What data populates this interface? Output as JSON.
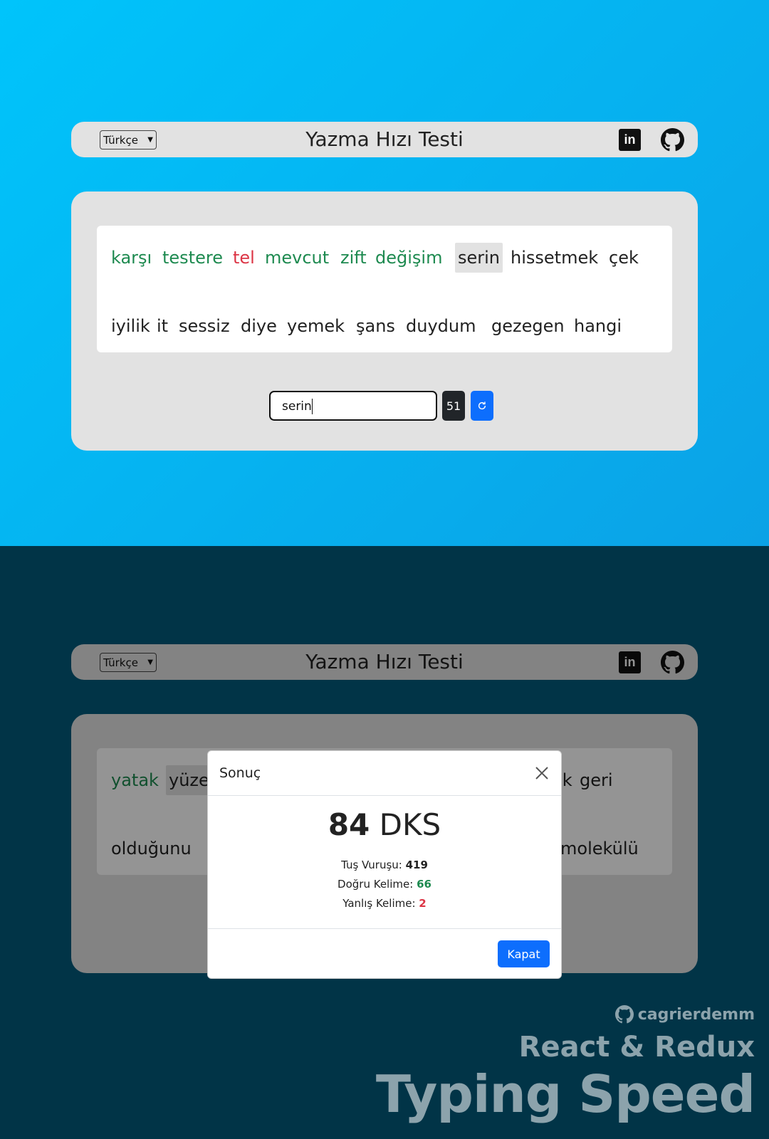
{
  "app_title": "Yazma Hızı Testi",
  "language": {
    "selected": "Türkçe"
  },
  "icons": {
    "linkedin": "linkedin-icon",
    "github": "github-icon",
    "refresh": "refresh-icon",
    "close": "close-icon"
  },
  "colors": {
    "correct": "#1e8a50",
    "wrong": "#dc3545",
    "primary": "#0d6efd",
    "dark": "#212529"
  },
  "top_test": {
    "line1": [
      {
        "text": "karşı",
        "status": "correct"
      },
      {
        "text": "testere",
        "status": "correct"
      },
      {
        "text": "tel",
        "status": "wrong"
      },
      {
        "text": "mevcut",
        "status": "correct"
      },
      {
        "text": "zift",
        "status": "correct"
      },
      {
        "text": "değişim",
        "status": "correct"
      },
      {
        "text": "serin",
        "status": "current"
      },
      {
        "text": "hissetmek",
        "status": "pending"
      },
      {
        "text": "çek",
        "status": "pending"
      }
    ],
    "line2": [
      {
        "text": "iyilik",
        "status": "pending"
      },
      {
        "text": "it",
        "status": "pending"
      },
      {
        "text": "sessiz",
        "status": "pending"
      },
      {
        "text": "diye",
        "status": "pending"
      },
      {
        "text": "yemek",
        "status": "pending"
      },
      {
        "text": "şans",
        "status": "pending"
      },
      {
        "text": "duydum",
        "status": "pending"
      },
      {
        "text": "gezegen",
        "status": "pending"
      },
      {
        "text": "hangi",
        "status": "pending"
      }
    ],
    "input_value": "serin",
    "timer": "51"
  },
  "bottom_test": {
    "visible_words": [
      {
        "text": "yatak",
        "status": "correct"
      },
      {
        "text": "yüze",
        "status": "current"
      },
      {
        "text": "ek",
        "status": "pending"
      },
      {
        "text": "geri",
        "status": "pending"
      },
      {
        "text": "olduğunu",
        "status": "pending"
      },
      {
        "text": "molekülü",
        "status": "pending"
      }
    ]
  },
  "result_modal": {
    "title": "Sonuç",
    "wpm_value": "84",
    "wpm_unit": "DKS",
    "keystrokes_label": "Tuş Vuruşu:",
    "keystrokes_value": "419",
    "correct_label": "Doğru Kelime:",
    "correct_value": "66",
    "wrong_label": "Yanlış Kelime:",
    "wrong_value": "2",
    "close_button": "Kapat"
  },
  "watermark": {
    "username": "cagrierdemm",
    "subtitle": "React & Redux",
    "title": "Typing Speed"
  }
}
